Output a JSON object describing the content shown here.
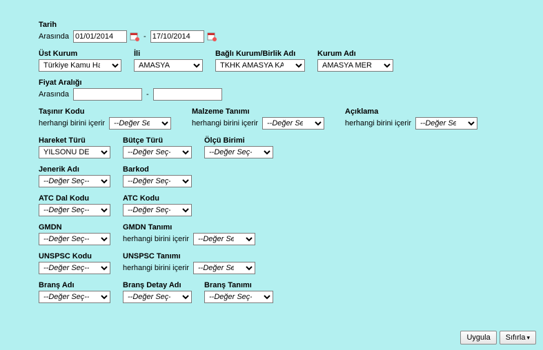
{
  "tarih": {
    "label": "Tarih",
    "arasinda": "Arasında",
    "date1": "01/01/2014",
    "date2": "17/10/2014"
  },
  "ustkurum": {
    "label": "Üst Kurum",
    "value": "Türkiye Kamu Hastar"
  },
  "ili": {
    "label": "İli",
    "value": "AMASYA"
  },
  "bagli": {
    "label": "Bağlı Kurum/Birlik Adı",
    "value": "TKHK AMASYA KAML"
  },
  "kurumadi": {
    "label": "Kurum Adı",
    "value": "AMASYA MERZİF"
  },
  "fiyat": {
    "label": "Fiyat Aralığı",
    "arasinda": "Arasında",
    "v1": "",
    "v2": ""
  },
  "tasinir": {
    "label": "Taşınır Kodu",
    "contains": "herhangi birini içerir",
    "value": "--Değer Seç--"
  },
  "malzeme": {
    "label": "Malzeme Tanımı",
    "contains": "herhangi birini içerir",
    "value": "--Değer Seç--"
  },
  "aciklama": {
    "label": "Açıklama",
    "contains": "herhangi birini içerir",
    "value": "--Değer Seç--"
  },
  "hareket": {
    "label": "Hareket Türü",
    "value": "YILSONU DEVRİ"
  },
  "butce": {
    "label": "Bütçe Türü",
    "value": "--Değer Seç--"
  },
  "olcu": {
    "label": "Ölçü Birimi",
    "value": "--Değer Seç--"
  },
  "jenerik": {
    "label": "Jenerik Adı",
    "value": "--Değer Seç--"
  },
  "barkod": {
    "label": "Barkod",
    "value": "--Değer Seç--"
  },
  "atcdal": {
    "label": "ATC Dal Kodu",
    "value": "--Değer Seç--"
  },
  "atckodu": {
    "label": "ATC Kodu",
    "value": "--Değer Seç--"
  },
  "gmdn": {
    "label": "GMDN",
    "value": "--Değer Seç--"
  },
  "gmdntanimi": {
    "label": "GMDN Tanımı",
    "contains": "herhangi birini içerir",
    "value": "--Değer Seç--"
  },
  "unspsckodu": {
    "label": "UNSPSC Kodu",
    "value": "--Değer Seç--"
  },
  "unspsctanimi": {
    "label": "UNSPSC Tanımı",
    "contains": "herhangi birini içerir",
    "value": "--Değer Seç--"
  },
  "bransadi": {
    "label": "Branş Adı",
    "value": "--Değer Seç--"
  },
  "bransdetay": {
    "label": "Branş Detay Adı",
    "value": "--Değer Seç--"
  },
  "branstanimi": {
    "label": "Branş Tanımı",
    "value": "--Değer Seç--"
  },
  "buttons": {
    "uygula": "Uygula",
    "sifirla": "Sıfırla"
  }
}
